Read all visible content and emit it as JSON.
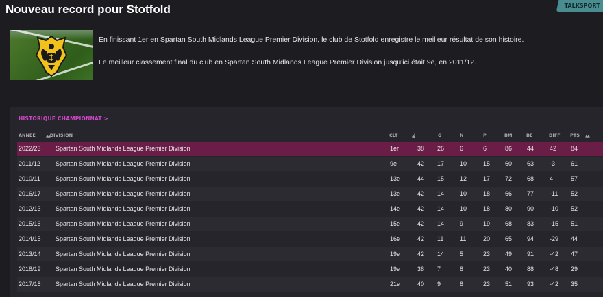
{
  "title": "Nouveau record pour Stotfold",
  "badge": "TALKSPORT",
  "messages": [
    "En finissant 1er en Spartan South Midlands League Premier Division, le club de Stotfold enregistre le meilleur résultat de son histoire.",
    "Le meilleur classement final du club en Spartan South Midlands League Premier Division jusqu'ici était 9e, en 2011/12."
  ],
  "history_link": "HISTORIQUE CHAMPIONNAT >",
  "columns": {
    "year": "ANNÉE",
    "division": "DIVISION",
    "pos": "CLT",
    "played": "J",
    "won": "G",
    "drawn": "N",
    "lost": "P",
    "gf": "BM",
    "ga": "BE",
    "diff": "DIFF",
    "pts": "PTS"
  },
  "rows": [
    {
      "year": "2022/23",
      "division": "Spartan South Midlands League Premier Division",
      "pos": "1er",
      "played": "38",
      "won": "26",
      "drawn": "6",
      "lost": "6",
      "gf": "86",
      "ga": "44",
      "diff": "42",
      "pts": "84"
    },
    {
      "year": "2011/12",
      "division": "Spartan South Midlands League Premier Division",
      "pos": "9e",
      "played": "42",
      "won": "17",
      "drawn": "10",
      "lost": "15",
      "gf": "60",
      "ga": "63",
      "diff": "-3",
      "pts": "61"
    },
    {
      "year": "2010/11",
      "division": "Spartan South Midlands League Premier Division",
      "pos": "13e",
      "played": "44",
      "won": "15",
      "drawn": "12",
      "lost": "17",
      "gf": "72",
      "ga": "68",
      "diff": "4",
      "pts": "57"
    },
    {
      "year": "2016/17",
      "division": "Spartan South Midlands League Premier Division",
      "pos": "13e",
      "played": "42",
      "won": "14",
      "drawn": "10",
      "lost": "18",
      "gf": "66",
      "ga": "77",
      "diff": "-11",
      "pts": "52"
    },
    {
      "year": "2012/13",
      "division": "Spartan South Midlands League Premier Division",
      "pos": "14e",
      "played": "42",
      "won": "14",
      "drawn": "10",
      "lost": "18",
      "gf": "80",
      "ga": "90",
      "diff": "-10",
      "pts": "52"
    },
    {
      "year": "2015/16",
      "division": "Spartan South Midlands League Premier Division",
      "pos": "15e",
      "played": "42",
      "won": "14",
      "drawn": "9",
      "lost": "19",
      "gf": "68",
      "ga": "83",
      "diff": "-15",
      "pts": "51"
    },
    {
      "year": "2014/15",
      "division": "Spartan South Midlands League Premier Division",
      "pos": "16e",
      "played": "42",
      "won": "11",
      "drawn": "11",
      "lost": "20",
      "gf": "65",
      "ga": "94",
      "diff": "-29",
      "pts": "44"
    },
    {
      "year": "2013/14",
      "division": "Spartan South Midlands League Premier Division",
      "pos": "19e",
      "played": "42",
      "won": "14",
      "drawn": "5",
      "lost": "23",
      "gf": "49",
      "ga": "91",
      "diff": "-42",
      "pts": "47"
    },
    {
      "year": "2018/19",
      "division": "Spartan South Midlands League Premier Division",
      "pos": "19e",
      "played": "38",
      "won": "7",
      "drawn": "8",
      "lost": "23",
      "gf": "40",
      "ga": "88",
      "diff": "-48",
      "pts": "29"
    },
    {
      "year": "2017/18",
      "division": "Spartan South Midlands League Premier Division",
      "pos": "21e",
      "played": "40",
      "won": "9",
      "drawn": "8",
      "lost": "23",
      "gf": "51",
      "ga": "93",
      "diff": "-42",
      "pts": "35"
    }
  ],
  "colors": {
    "background": "#1d1c21",
    "panel": "#26252b",
    "highlight_row": "#6a1e47",
    "link": "#d046c8",
    "badge": "#4a8d90"
  },
  "icons": {
    "crest": "club-crest-icon",
    "sort": "sort-arrows-icon"
  }
}
